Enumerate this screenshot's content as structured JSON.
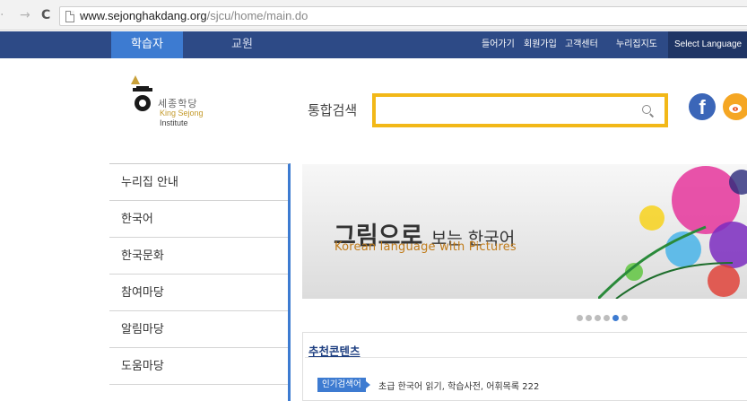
{
  "browser": {
    "back_icon": "back-arrow-icon",
    "forward_icon": "forward-arrow-icon",
    "reload_icon": "reload-icon",
    "url_domain": "www.sejonghakdang.org",
    "url_path": "/sjcu/home/main.do"
  },
  "topnav": {
    "learner_tab": "학습자",
    "teacher_tab": "교원",
    "utility_links": [
      "들어가기",
      "회원가입",
      "고객센터",
      "누리집지도"
    ],
    "select_language": "Select Language"
  },
  "logo": {
    "korean_text": "세종학당",
    "english_line1": "King Sejong",
    "english_line2": "Institute"
  },
  "search": {
    "label": "통합검색",
    "placeholder": ""
  },
  "social": {
    "facebook_glyph": "f"
  },
  "sidemenu": {
    "items": [
      "누리집 안내",
      "한국어",
      "한국문화",
      "참여마당",
      "알림마당",
      "도움마당"
    ]
  },
  "banner": {
    "title_bold": "그림으로",
    "title_rest": "보는 한국어",
    "subtitle": "Korean language with Pictures",
    "slide_count": 6,
    "active_slide": 5
  },
  "recommended": {
    "title": "추천콘텐츠",
    "popular_tag": "인기검색어",
    "popular_terms": "초급 한국어 읽기, 학습사전, 어휘목록 222"
  },
  "colors": {
    "nav_bg": "#2d4a86",
    "accent_blue": "#3d7bd1",
    "search_border": "#f2b818",
    "facebook": "#3b66b8",
    "weibo": "#f5a623"
  }
}
